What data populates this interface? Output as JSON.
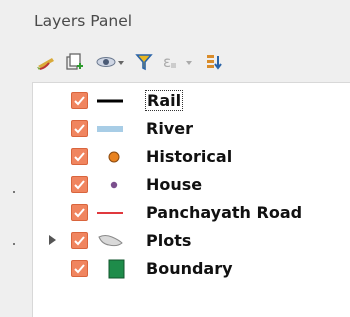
{
  "panel": {
    "title": "Layers Panel"
  },
  "toolbar": {
    "buttons": [
      {
        "name": "style-layer-icon"
      },
      {
        "name": "add-group-icon"
      },
      {
        "name": "visibility-eye-icon"
      },
      {
        "name": "filter-icon"
      },
      {
        "name": "expression-filter-icon"
      },
      {
        "name": "expand-all-icon"
      }
    ]
  },
  "layers": [
    {
      "label": "Rail",
      "checked": true,
      "symbol": "black-line",
      "color": "#000000",
      "expandable": false
    },
    {
      "label": "River",
      "checked": true,
      "symbol": "blue-line",
      "color": "#a8cde6",
      "expandable": false
    },
    {
      "label": "Historical",
      "checked": true,
      "symbol": "orange-dot",
      "color": "#e8821f",
      "expandable": false
    },
    {
      "label": "House",
      "checked": true,
      "symbol": "purple-dot",
      "color": "#7b4f8d",
      "expandable": false
    },
    {
      "label": "Panchayath Road",
      "checked": true,
      "symbol": "red-line",
      "color": "#e0393e",
      "expandable": false
    },
    {
      "label": "Plots",
      "checked": true,
      "symbol": "grey-polygon",
      "color": "#d9d9d9",
      "expandable": true
    },
    {
      "label": "Boundary",
      "checked": true,
      "symbol": "green-fill",
      "color": "#1e8c4a",
      "expandable": false
    }
  ]
}
